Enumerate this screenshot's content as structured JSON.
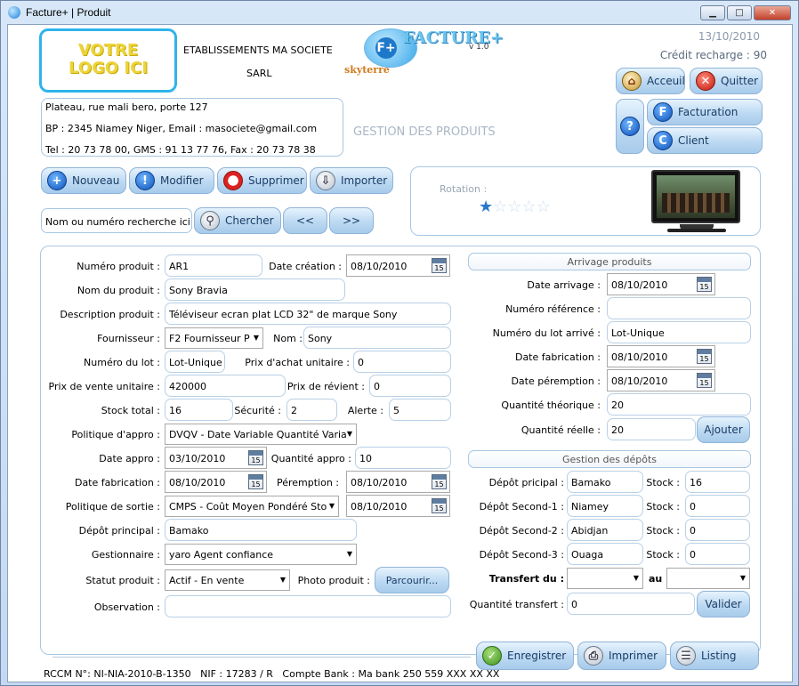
{
  "window": {
    "title": "Facture+ | Produit",
    "min": "▁",
    "max": "□",
    "close": "✕"
  },
  "header": {
    "logo_line1": "VOTRE",
    "logo_line2": "LOGO ICI",
    "company": "ETABLISSEMENTS MA SOCIETE",
    "company_type": "SARL",
    "app_name": "FACTURE+",
    "app_version": "v 1.0",
    "app_vendor": "skyterre",
    "date": "13/10/2010",
    "credit": "Crédit recharge : 90",
    "address1": "Plateau, rue mali bero, porte 127",
    "address2": "BP : 2345 Niamey Niger, Email : masociete@gmail.com",
    "address3": "Tel : 20 73 78 00, GMS : 91 13 77 76, Fax : 20 73 78 38",
    "section_title": "GESTION DES PRODUITS"
  },
  "nav": {
    "accueil": "Acceuil",
    "quitter": "Quitter",
    "help": "?",
    "facturation": "Facturation",
    "client": "Client"
  },
  "toolbar": {
    "nouveau": "Nouveau",
    "modifier": "Modifier",
    "supprimer": "Supprimer",
    "importer": "Importer"
  },
  "search": {
    "placeholder": "Nom ou numéro recherche ici !",
    "chercher": "Chercher",
    "prev": "<<",
    "next": ">>"
  },
  "rotation": {
    "label": "Rotation :",
    "stars": 1,
    "max": 5
  },
  "form": {
    "numero_label": "Numéro produit :",
    "numero": "AR1",
    "date_creation_label": "Date création :",
    "date_creation": "08/10/2010",
    "nom_label": "Nom du produit :",
    "nom": "Sony Bravia",
    "desc_label": "Description produit :",
    "desc": "Téléviseur ecran plat LCD 32\" de marque Sony",
    "fournisseur_label": "Fournisseur :",
    "fournisseur": "F2 Fournisseur P",
    "nom_f_label": "Nom :",
    "nom_f": "Sony",
    "lot_label": "Numéro du lot :",
    "lot": "Lot-Unique",
    "prix_achat_label": "Prix d'achat unitaire :",
    "prix_achat": "0",
    "prix_vente_label": "Prix de vente unitaire :",
    "prix_vente": "420000",
    "prix_revient_label": "Prix de révient :",
    "prix_revient": "0",
    "stock_label": "Stock total :",
    "stock": "16",
    "securite_label": "Sécurité :",
    "securite": "2",
    "alerte_label": "Alerte :",
    "alerte": "5",
    "politique_appro_label": "Politique d'appro :",
    "politique_appro": "DVQV - Date Variable Quantité Varia",
    "date_appro_label": "Date appro :",
    "date_appro": "03/10/2010",
    "quantite_appro_label": "Quantité appro :",
    "quantite_appro": "10",
    "date_fab_label": "Date fabrication :",
    "date_fab": "08/10/2010",
    "peremption_label": "Péremption :",
    "peremption": "08/10/2010",
    "politique_sortie_label": "Politique de sortie :",
    "politique_sortie": "CMPS - Coût Moyen Pondéré Sto",
    "date_sortie": "08/10/2010",
    "depot_label": "Dépôt principal :",
    "depot": "Bamako",
    "gestionnaire_label": "Gestionnaire :",
    "gestionnaire": "yaro Agent confiance",
    "statut_label": "Statut produit :",
    "statut": "Actif - En vente",
    "photo_label": "Photo produit :",
    "parcourir": "Parcourir...",
    "observation_label": "Observation :",
    "observation": ""
  },
  "arrivage": {
    "title": "Arrivage produits",
    "date_label": "Date arrivage :",
    "date": "08/10/2010",
    "ref_label": "Numéro référence :",
    "ref": "",
    "lot_label": "Numéro du lot arrivé :",
    "lot": "Lot-Unique",
    "fab_label": "Date fabrication :",
    "fab": "08/10/2010",
    "per_label": "Date péremption :",
    "per": "08/10/2010",
    "qt_label": "Quantité théorique :",
    "qt": "20",
    "qr_label": "Quantité réelle :",
    "qr": "20",
    "ajouter": "Ajouter"
  },
  "depots": {
    "title": "Gestion des dépôts",
    "stock_label": "Stock :",
    "rows": [
      {
        "label": "Dépôt pricipal :",
        "name": "Bamako",
        "stock": "16"
      },
      {
        "label": "Dépôt Second-1 :",
        "name": "Niamey",
        "stock": "0"
      },
      {
        "label": "Dépôt Second-2 :",
        "name": "Abidjan",
        "stock": "0"
      },
      {
        "label": "Dépôt Second-3 :",
        "name": "Ouaga",
        "stock": "0"
      }
    ],
    "transfert_label": "Transfert du :",
    "au_label": "au",
    "qte_label": "Quantité transfert :",
    "qte": "0",
    "valider": "Valider"
  },
  "footer": {
    "enregistrer": "Enregistrer",
    "imprimer": "Imprimer",
    "listing": "Listing",
    "legal": "RCCM N°: NI-NIA-2010-B-1350   NIF : 17283 / R   Compte Bank : Ma bank 250 559 XXX XX XX"
  }
}
